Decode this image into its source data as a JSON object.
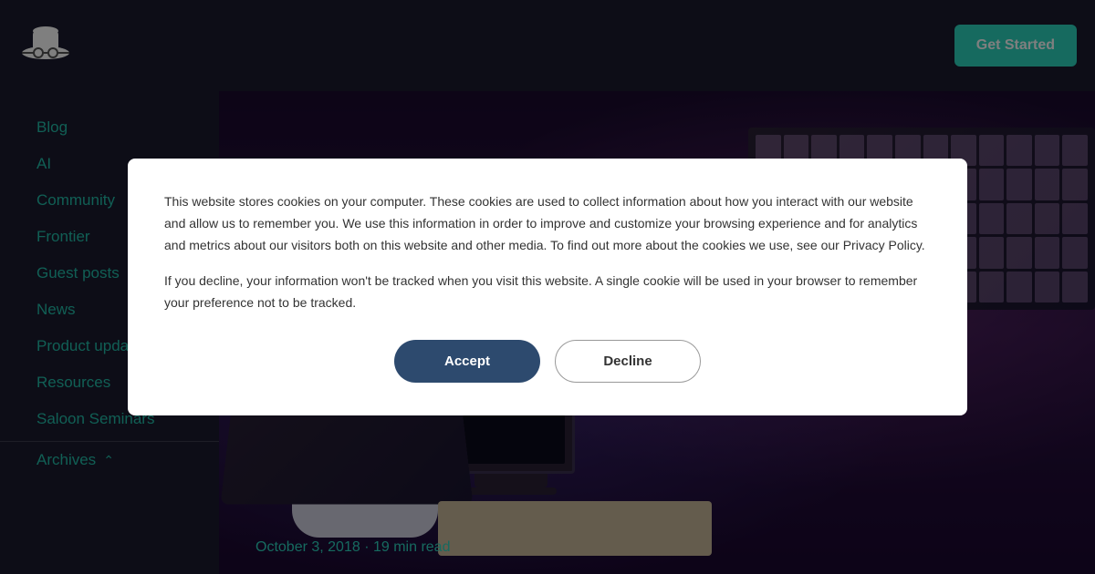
{
  "header": {
    "logo_alt": "Hacker Noon Logo",
    "get_started_label": "Get Started"
  },
  "sidebar": {
    "nav_items": [
      {
        "label": "Blog",
        "href": "#"
      },
      {
        "label": "AI",
        "href": "#"
      },
      {
        "label": "Community",
        "href": "#"
      },
      {
        "label": "Frontier",
        "href": "#"
      },
      {
        "label": "Guest posts",
        "href": "#"
      },
      {
        "label": "News",
        "href": "#"
      },
      {
        "label": "Product updates",
        "href": "#"
      },
      {
        "label": "Resources",
        "href": "#"
      },
      {
        "label": "Saloon Seminars",
        "href": "#"
      }
    ],
    "archives_label": "Archives"
  },
  "hero": {
    "date": "October 3, 2018",
    "read_time": "19 min read",
    "date_separator": "·"
  },
  "cookie_modal": {
    "primary_text": "This website stores cookies on your computer. These cookies are used to collect information about how you interact with our website and allow us to remember you. We use this information in order to improve and customize your browsing experience and for analytics and metrics about our visitors both on this website and other media. To find out more about the cookies we use, see our Privacy Policy.",
    "secondary_text": "If you decline, your information won't be tracked when you visit this website. A single cookie will be used in your browser to remember your preference not to be tracked.",
    "accept_label": "Accept",
    "decline_label": "Decline"
  }
}
